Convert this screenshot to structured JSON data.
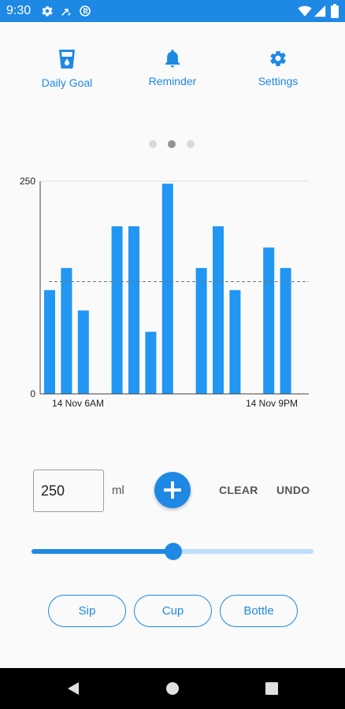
{
  "status_bar": {
    "time": "9:30",
    "left_icons": [
      "gear-icon",
      "call-forward-icon",
      "sync-icon"
    ],
    "right_icons": [
      "wifi-icon",
      "signal-icon",
      "battery-icon"
    ],
    "color": "#1e88e5"
  },
  "top_actions": [
    {
      "label": "Daily Goal",
      "icon": "water-glass-icon"
    },
    {
      "label": "Reminder",
      "icon": "bell-icon"
    },
    {
      "label": "Settings",
      "icon": "gear-icon"
    }
  ],
  "pager": {
    "pages": 3,
    "active": 1
  },
  "chart_data": {
    "type": "bar",
    "values": [
      122,
      148,
      98,
      0,
      197,
      197,
      73,
      247,
      0,
      148,
      197,
      122,
      0,
      172,
      148
    ],
    "x_tick_labels": [
      "14 Nov 6AM",
      "14 Nov 9PM"
    ],
    "y_tick_labels": [
      "250",
      "0"
    ],
    "ylim": [
      0,
      250
    ],
    "average_line": 132,
    "bar_color": "#2196f3",
    "average_line_color": "#757575"
  },
  "input": {
    "amount": "250",
    "unit": "ml"
  },
  "buttons": {
    "add_icon": "plus-icon",
    "clear": "CLEAR",
    "undo": "UNDO"
  },
  "slider": {
    "value_fraction": 0.504
  },
  "presets": [
    "Sip",
    "Cup",
    "Bottle"
  ],
  "nav": [
    "back-icon",
    "home-icon",
    "recents-icon"
  ],
  "accent_color": "#1e88e5"
}
